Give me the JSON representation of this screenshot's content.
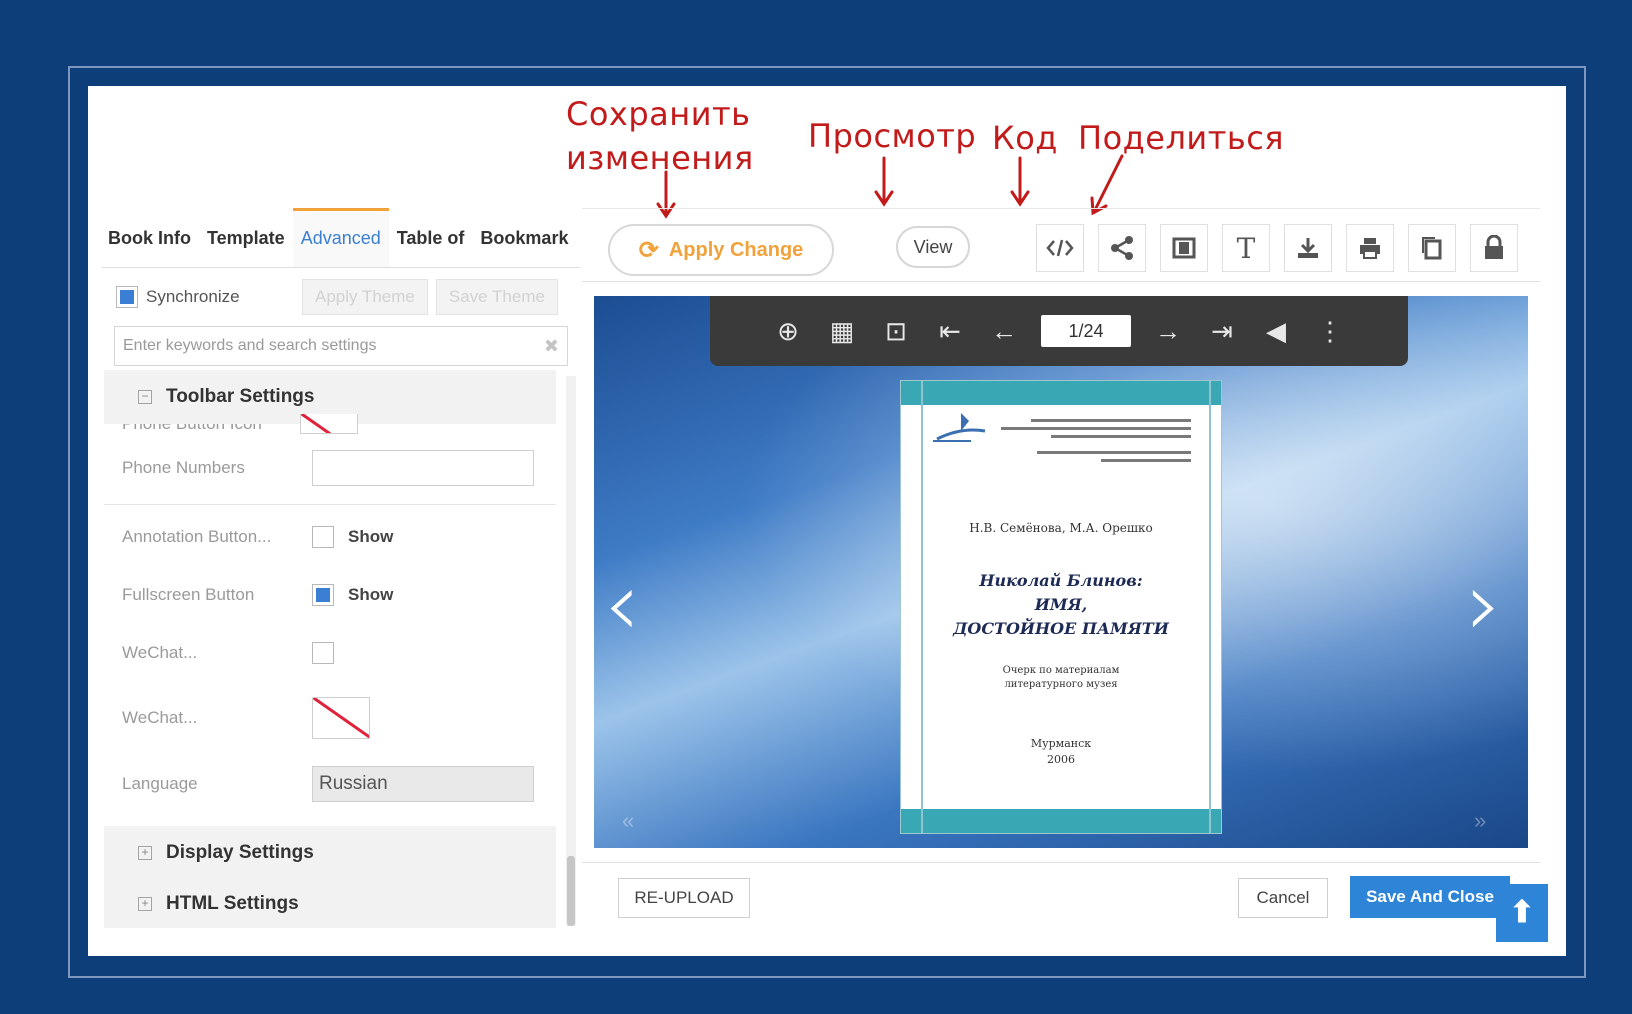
{
  "annotations": {
    "save": "Сохранить\nизменения",
    "save_line1": "Сохранить",
    "save_line2": "изменения",
    "view": "Просмотр",
    "code": "Код",
    "share": "Поделиться"
  },
  "tabs": [
    "Book Info",
    "Template",
    "Advanced",
    "Table of",
    "Bookmark"
  ],
  "active_tab": "Advanced",
  "sync": {
    "label": "Synchronize",
    "checked": true
  },
  "theme_buttons": {
    "apply": "Apply Theme",
    "save": "Save Theme"
  },
  "search": {
    "placeholder": "Enter keywords and search settings",
    "clear_icon": "close-icon"
  },
  "sections": {
    "toolbar": "Toolbar Settings",
    "display": "Display Settings",
    "html": "HTML Settings"
  },
  "settings": {
    "phone_button_icon": "Phone Button Icon",
    "phone_numbers": {
      "label": "Phone Numbers",
      "value": ""
    },
    "annotation": {
      "label": "Annotation Button...",
      "value": "Show",
      "checked": false
    },
    "fullscreen": {
      "label": "Fullscreen Button",
      "value": "Show",
      "checked": true
    },
    "wechat1": {
      "label": "WeChat...",
      "checked": false
    },
    "wechat2": {
      "label": "WeChat..."
    },
    "language": {
      "label": "Language",
      "value": "Russian"
    }
  },
  "toolbar": {
    "apply_change": "Apply Change",
    "view": "View",
    "icons": [
      "code-icon",
      "share-icon",
      "book-icon",
      "text-icon",
      "download-icon",
      "print-icon",
      "copy-icon",
      "lock-icon"
    ]
  },
  "viewer": {
    "page_indicator": "1/24",
    "icons": [
      "zoom-in-icon",
      "thumbnails-icon",
      "fit-icon",
      "first-page-icon",
      "prev-page-icon",
      "next-page-icon",
      "last-page-icon",
      "sound-icon",
      "more-icon"
    ]
  },
  "book_cover": {
    "authors": "Н.В. Семёнова, М.А. Орешко",
    "title_line1": "Николай Блинов:",
    "title_line2": "ИМЯ,",
    "title_line3": "ДОСТОЙНОЕ ПАМЯТИ",
    "subtitle_line1": "Очерк по материалам",
    "subtitle_line2": "литературного музея",
    "city": "Мурманск",
    "year": "2006"
  },
  "bottom": {
    "reupload": "RE-UPLOAD",
    "cancel": "Cancel",
    "save_close": "Save And Close"
  },
  "colors": {
    "background": "#0e3e7a",
    "accent": "#f2a23a",
    "primary": "#2e85d8",
    "annotation": "#c21b1b"
  }
}
